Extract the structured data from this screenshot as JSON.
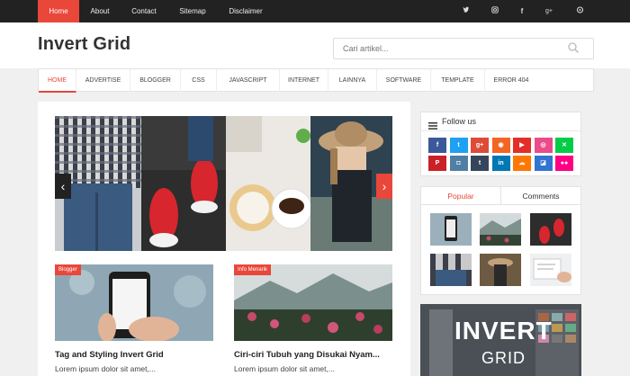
{
  "top_nav": {
    "links": [
      "Home",
      "About",
      "Contact",
      "Sitemap",
      "Disclaimer"
    ],
    "social_icons": [
      "twitter-icon",
      "instagram-icon",
      "facebook-icon",
      "google-plus-icon",
      "flickr-icon"
    ]
  },
  "header": {
    "logo": "Invert Grid",
    "search_placeholder": "Cari artikel..."
  },
  "main_nav": {
    "items": [
      "HOME",
      "ADVERTISE",
      "BLOGGER",
      "CSS",
      "JAVASCRIPT",
      "INTERNET",
      "LAINNYA",
      "SOFTWARE",
      "TEMPLATE",
      "ERROR 404"
    ]
  },
  "posts": [
    {
      "label": "Blogger",
      "title": "Tag and Styling Invert Grid",
      "excerpt": "Lorem ipsum dolor sit amet,..."
    },
    {
      "label": "Info Menarik",
      "title": "Ciri-ciri Tubuh yang Disukai Nyam...",
      "excerpt": "Lorem ipsum dolor sit amet,..."
    }
  ],
  "sidebar": {
    "follow_title": "Follow us",
    "social_grid": [
      "facebook-icon",
      "twitter-icon",
      "google-plus-icon",
      "rss-icon",
      "youtube-icon",
      "dribbble-icon",
      "deviantart-icon",
      "pinterest-icon",
      "instagram-icon",
      "tumblr-icon",
      "linkedin-icon",
      "soundcloud-icon",
      "delicious-icon",
      "flickr-icon"
    ],
    "social_colors": [
      "#3b5998",
      "#1da1f2",
      "#dd4b39",
      "#f26522",
      "#e52d27",
      "#ea4c89",
      "#05cc47",
      "#cb2027",
      "#517fa4",
      "#35465c",
      "#0077b5",
      "#ff7700",
      "#3274d1",
      "#ff0084"
    ],
    "tabs": [
      "Popular",
      "Comments"
    ],
    "ad_text": [
      "INVERT",
      "GRID"
    ]
  },
  "colors": {
    "accent": "#e8473a",
    "topbar": "#222222"
  }
}
